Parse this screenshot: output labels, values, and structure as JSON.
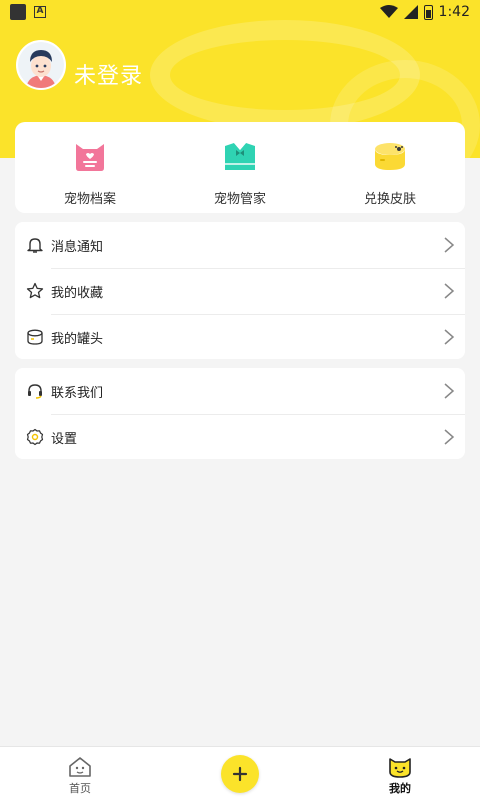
{
  "status_bar": {
    "time": "1:42"
  },
  "header": {
    "user_name": "未登录"
  },
  "features": [
    {
      "label": "宠物档案",
      "icon": "pet-file-icon",
      "color": "#f2769a"
    },
    {
      "label": "宠物管家",
      "icon": "pet-butler-icon",
      "color": "#2fd3b3"
    },
    {
      "label": "兑换皮肤",
      "icon": "can-icon",
      "color": "#fbd934"
    }
  ],
  "menu_group_1": [
    {
      "label": "消息通知",
      "icon": "bell-icon"
    },
    {
      "label": "我的收藏",
      "icon": "star-icon"
    },
    {
      "label": "我的罐头",
      "icon": "can-outline-icon"
    }
  ],
  "menu_group_2": [
    {
      "label": "联系我们",
      "icon": "headset-icon"
    },
    {
      "label": "设置",
      "icon": "settings-icon"
    }
  ],
  "bottom_nav": {
    "home_label": "首页",
    "add_icon": "plus-icon",
    "mine_label": "我的"
  },
  "colors": {
    "accent": "#fbe32a",
    "background": "#f4f4f4"
  }
}
